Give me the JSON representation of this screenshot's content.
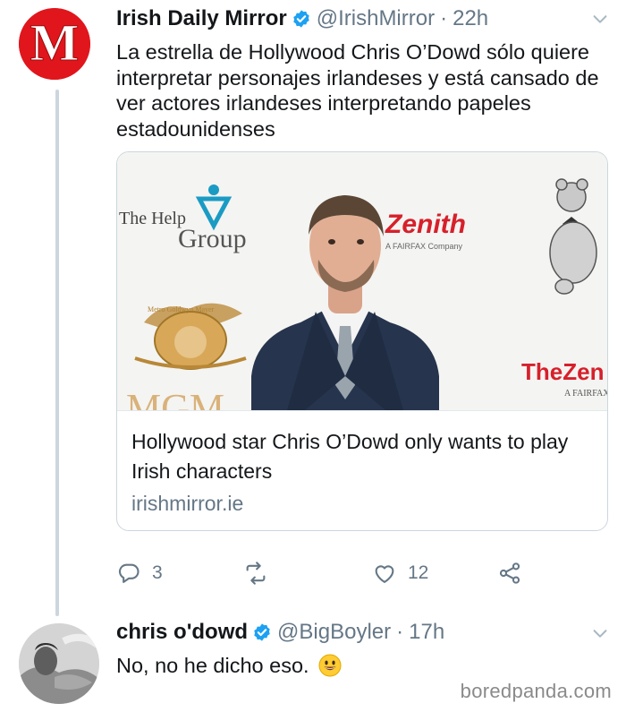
{
  "tweet": {
    "display_name": "Irish Daily Mirror",
    "handle": "@IrishMirror",
    "separator": "·",
    "time": "22h",
    "avatar_letter": "M",
    "text": "La estrella de Hollywood Chris O’Dowd sólo quiere interpretar personajes irlandeses y está cansado de ver actores irlandeses interpretando papeles estadounidenses",
    "card": {
      "title": "Hollywood star Chris O’Dowd only wants to play Irish characters",
      "domain": "irishmirror.ie",
      "backdrop": {
        "help_group_line1": "The Help",
        "help_group_line2": "Group",
        "zenith": "Zenith",
        "zenith_sub": "A FAIRFAX Company",
        "mgm": "MGM",
        "mgm_ribbon": "Metro Goldwyn Mayer",
        "thezen": "TheZen",
        "fairfax": "A FAIRFAX"
      }
    },
    "actions": {
      "replies": "3",
      "retweets": "",
      "likes": "12"
    }
  },
  "reply": {
    "display_name": "chris o'dowd",
    "handle": "@BigBoyler",
    "separator": "·",
    "time": "17h",
    "text": "No, no he dicho eso.",
    "emoji": "grinning-face"
  },
  "watermark": "boredpanda.com",
  "colors": {
    "brand_red": "#e0161c",
    "verified_blue": "#1da1f2",
    "muted_text": "#657786",
    "border": "#ccd6dd"
  }
}
